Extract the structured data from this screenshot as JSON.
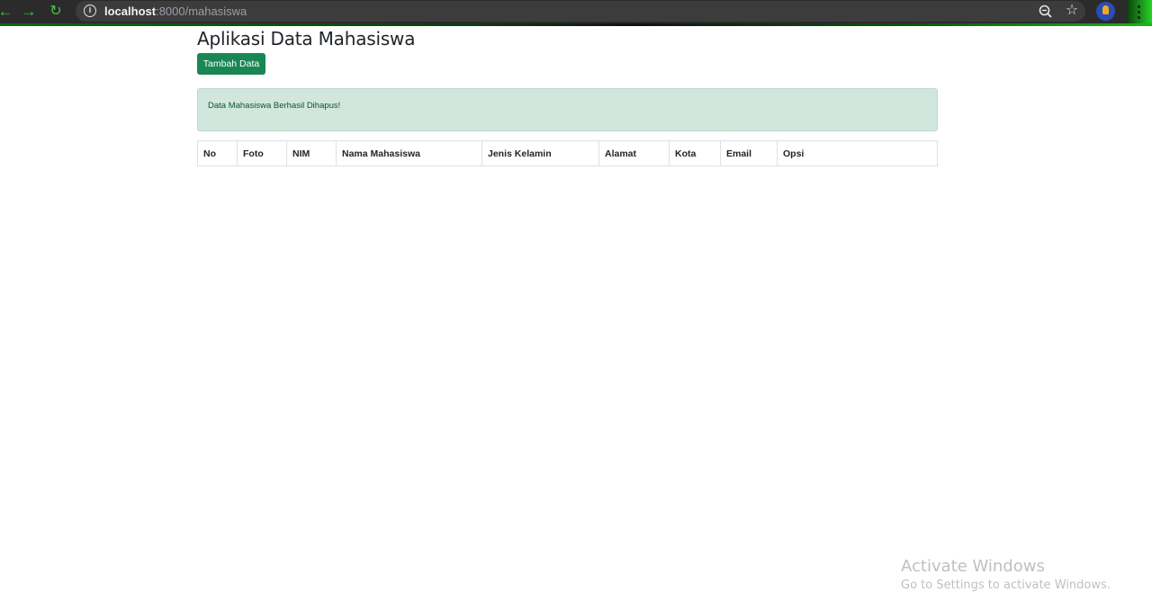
{
  "browser": {
    "url_host": "localhost",
    "url_path": ":8000/mahasiswa",
    "back_icon": "arrow-left-icon",
    "forward_icon": "arrow-right-icon",
    "reload_icon": "reload-icon"
  },
  "page": {
    "title": "Aplikasi Data Mahasiswa",
    "add_button_label": "Tambah Data",
    "alert_message": "Data Mahasiswa Berhasil Dihapus!",
    "table": {
      "columns": [
        "No",
        "Foto",
        "NIM",
        "Nama Mahasiswa",
        "Jenis Kelamin",
        "Alamat",
        "Kota",
        "Email",
        "Opsi"
      ],
      "rows": []
    }
  },
  "watermark": {
    "title": "Activate Windows",
    "subtitle": "Go to Settings to activate Windows."
  },
  "colors": {
    "accent_green": "#198754",
    "alert_bg": "#d1e7dd",
    "chrome_bg": "#2b2b2b"
  }
}
